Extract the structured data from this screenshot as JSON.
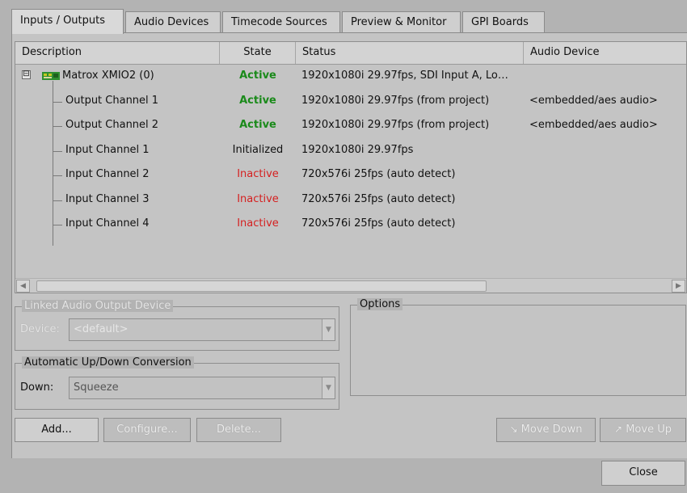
{
  "tabs": [
    {
      "label": "Inputs / Outputs",
      "active": true
    },
    {
      "label": "Audio Devices"
    },
    {
      "label": "Timecode Sources"
    },
    {
      "label": "Preview & Monitor"
    },
    {
      "label": "GPI Boards"
    }
  ],
  "table": {
    "columns": [
      "Description",
      "State",
      "Status",
      "Audio Device"
    ],
    "rows": [
      {
        "description": "Matrox XMIO2 (0)",
        "state": "Active",
        "status": "1920x1080i 29.97fps, SDI Input A, Lo…",
        "audio": "",
        "level": 0,
        "expander": "⊟"
      },
      {
        "description": "Output Channel 1",
        "state": "Active",
        "status": "1920x1080i 29.97fps (from project)",
        "audio": "<embedded/aes audio>",
        "level": 1
      },
      {
        "description": "Output Channel 2",
        "state": "Active",
        "status": "1920x1080i 29.97fps (from project)",
        "audio": "<embedded/aes audio>",
        "level": 1
      },
      {
        "description": "Input Channel 1",
        "state": "Initialized",
        "status": "1920x1080i 29.97fps",
        "audio": "",
        "level": 1
      },
      {
        "description": "Input Channel 2",
        "state": "Inactive",
        "status": "720x576i 25fps (auto detect)",
        "audio": "",
        "level": 1
      },
      {
        "description": "Input Channel 3",
        "state": "Inactive",
        "status": "720x576i 25fps (auto detect)",
        "audio": "",
        "level": 1
      },
      {
        "description": "Input Channel 4",
        "state": "Inactive",
        "status": "720x576i 25fps (auto detect)",
        "audio": "",
        "level": 1
      }
    ]
  },
  "linked_audio": {
    "title": "Linked Audio Output Device",
    "device_label": "Device:",
    "device_value": "<default>"
  },
  "options": {
    "title": "Options"
  },
  "conversion": {
    "title": "Automatic Up/Down Conversion",
    "down_label": "Down:",
    "down_value": "Squeeze"
  },
  "buttons": {
    "add": "Add...",
    "configure": "Configure...",
    "delete": "Delete...",
    "move_down": "Move Down",
    "move_up": "Move Up",
    "close": "Close"
  },
  "colors": {
    "active": "#1a8a1a",
    "inactive": "#d52020"
  }
}
